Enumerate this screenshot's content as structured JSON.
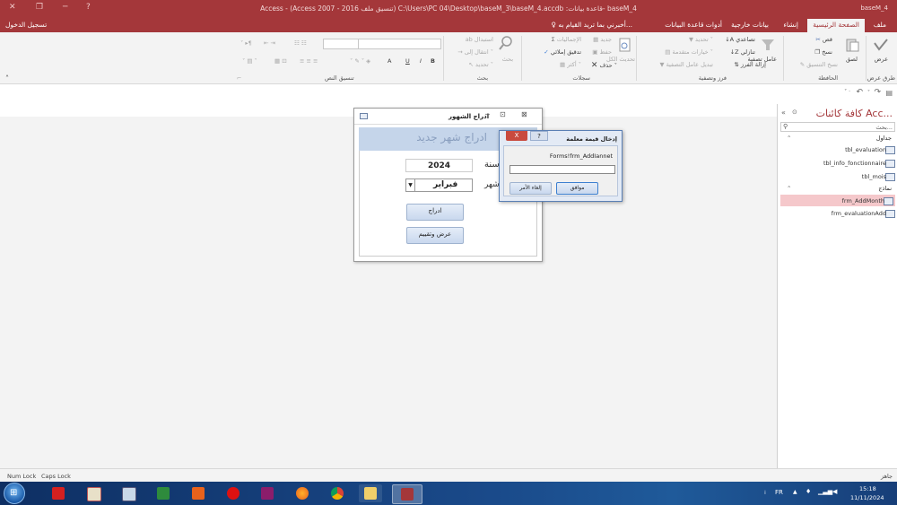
{
  "title_bar": {
    "title": "Access - (Access 2007 - 2016 تنسيق ملف) C:\\Users\\PC 04\\Desktop\\baseM_3\\baseM_4.accdb :قاعدة بيانات- baseM_4",
    "sign_in": "تسجيل الدخول"
  },
  "tabs": {
    "file": "ملف",
    "home": "الصفحة الرئيسية",
    "create": "إنشاء",
    "external": "بيانات خارجية",
    "db_tools": "أدوات قاعدة البيانات",
    "tell_me": "أخبرني بما تريد القيام به..."
  },
  "ribbon": {
    "views": {
      "view": "عرض",
      "group": "طرق عرض"
    },
    "clipboard": {
      "paste": "لصق",
      "cut": "قص",
      "copy": "نسخ",
      "format_painter": "نسخ التنسيق",
      "group": "الحافظة"
    },
    "sort_filter": {
      "filter": "عامل تصفية",
      "ascending": "تصاعدي",
      "descending": "تنازلي",
      "remove_sort": "إزالة الفرز",
      "selection": "تحديد",
      "advanced": "خيارات متقدمة",
      "toggle": "تبديل عامل التصفية",
      "group": "فرز وتصفية"
    },
    "records": {
      "refresh": "تحديث الكل",
      "new": "جديد",
      "save": "حفظ",
      "delete": "حذف",
      "totals": "الإجماليات",
      "spelling": "تدقيق إملائي",
      "more": "أكثر",
      "group": "سجلات"
    },
    "find": {
      "find": "بحث",
      "replace": "استبدال",
      "goto": "انتقال إلى",
      "select": "تحديد",
      "group": "بحث"
    },
    "text_format": {
      "group": "تنسيق النص",
      "bold": "B",
      "italic": "I",
      "underline": "U",
      "font_color": "A"
    }
  },
  "nav_pane": {
    "title": "كافة كائنات Acc...",
    "search_placeholder": "بحث...",
    "tables_header": "جداول",
    "tables": [
      "tbl_evaluation",
      "tbl_info_fonctionnaire",
      "tbl_mois"
    ],
    "forms_header": "نماذج",
    "forms": [
      "frm_AddMonth",
      "frm_evaluationAdd"
    ]
  },
  "form_window": {
    "tab_title": "ادراج الشهور",
    "header": "ادراج شهر جديد",
    "year_label": "سنة",
    "year_value": "2024",
    "month_label": "شهر",
    "month_value": "فبراير",
    "insert_btn": "ادراج",
    "view_btn": "عرض وتقييم"
  },
  "dialog": {
    "title": "إدخال قيمة معلمة",
    "prompt": "Forms!frm_AddIannet",
    "input_value": "",
    "ok": "موافق",
    "cancel": "إلغاء الأمر",
    "help": "?",
    "close": "X"
  },
  "status_bar": {
    "ready": "جاهز",
    "num_lock": "Num Lock",
    "caps_lock": "Caps Lock"
  },
  "taskbar": {
    "lang": "FR",
    "time": "15:18",
    "date": "11/11/2024"
  }
}
